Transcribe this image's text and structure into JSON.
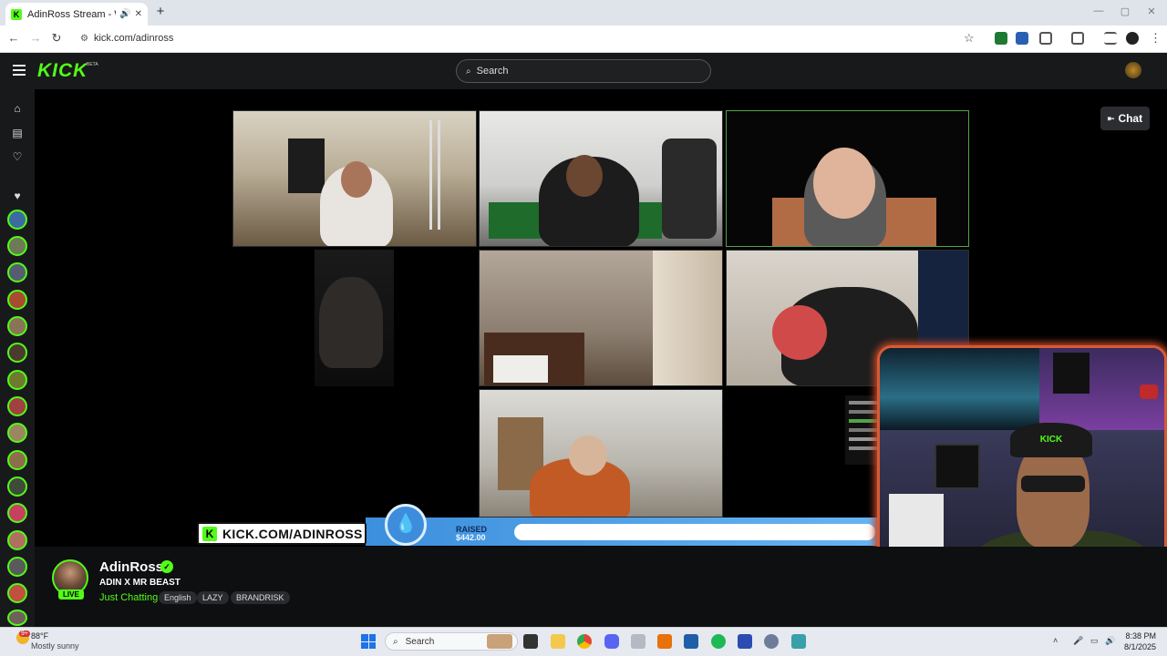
{
  "browser": {
    "tab_title": "AdinRoss Stream - Watch L",
    "url": "kick.com/adinross"
  },
  "kick": {
    "logo": "KICK",
    "beta": "BETA",
    "search_placeholder": "Search",
    "chat_button": "Chat"
  },
  "banner": {
    "kick_url": "KICK.COM/ADINROSS",
    "raised_label": "RAISED",
    "raised_amount": "$442.00"
  },
  "stream": {
    "streamer": "AdinRoss",
    "live": "LIVE",
    "title": "ADIN X MR BEAST",
    "category": "Just Chatting",
    "tags": [
      "English",
      "LAZY",
      "BRANDRISK"
    ]
  },
  "facecam": {
    "hat_text": "KICK"
  },
  "taskbar": {
    "weather_badge": "9+",
    "temperature": "88°F",
    "weather": "Mostly sunny",
    "search_placeholder": "Search",
    "time": "8:38 PM",
    "date": "8/1/2025"
  },
  "colors": {
    "kick_green": "#53fc18",
    "header_bg": "#18191b",
    "banner_blue": "#3c8fdc"
  }
}
